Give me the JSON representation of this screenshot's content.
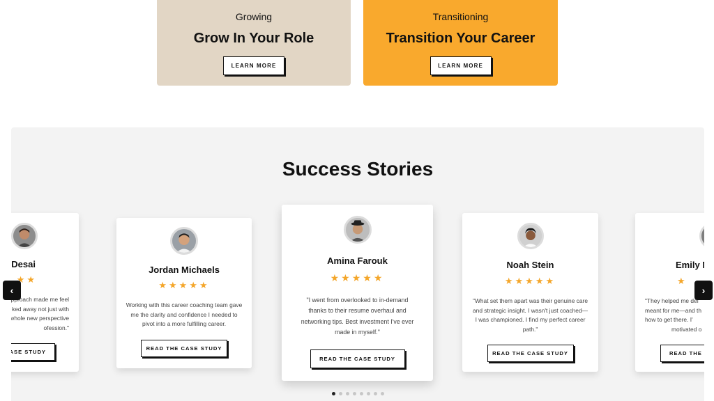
{
  "top_cards": [
    {
      "eyebrow": "Growing",
      "title": "Grow In Your Role",
      "button": "LEARN MORE"
    },
    {
      "eyebrow": "Transitioning",
      "title": "Transition Your Career",
      "button": "LEARN MORE"
    }
  ],
  "section": {
    "title": "Success Stories"
  },
  "stars": "★★★★★",
  "cards": [
    {
      "name": "Desai",
      "quote": [
        "pproach made me feel",
        "ked away not just with",
        "whole new perspective",
        "ofession.\""
      ],
      "button": "ASE STUDY",
      "stars": "★★"
    },
    {
      "name": "Jordan Michaels",
      "quote": [
        "Working with this career coaching team gave",
        "me the clarity and confidence I needed to",
        "pivot into a more fulfilling career."
      ],
      "button": "READ THE CASE STUDY"
    },
    {
      "name": "Amina Farouk",
      "quote": [
        "\"I went from overlooked to in-demand",
        "thanks to their resume overhaul and",
        "networking tips. Best investment I've ever",
        "made in myself.\""
      ],
      "button": "READ THE CASE STUDY"
    },
    {
      "name": "Noah Stein",
      "quote": [
        "\"What set them apart was their genuine care",
        "and strategic insight. I wasn't just coached—",
        "I was championed. I find my perfect career",
        "path.\""
      ],
      "button": "READ THE CASE STUDY"
    },
    {
      "name": "Emily N",
      "quote": [
        "\"They helped me def",
        "meant for me—and th",
        "how to get there. I'",
        "motivated o"
      ],
      "button": "READ THE C",
      "stars": "★"
    }
  ],
  "carousel": {
    "prev": "‹",
    "next": "›",
    "slides": 8,
    "active": 0
  },
  "colors": {
    "accent_orange": "#f9a92d",
    "beige": "#e2d6c5",
    "star": "#f4a62a"
  }
}
